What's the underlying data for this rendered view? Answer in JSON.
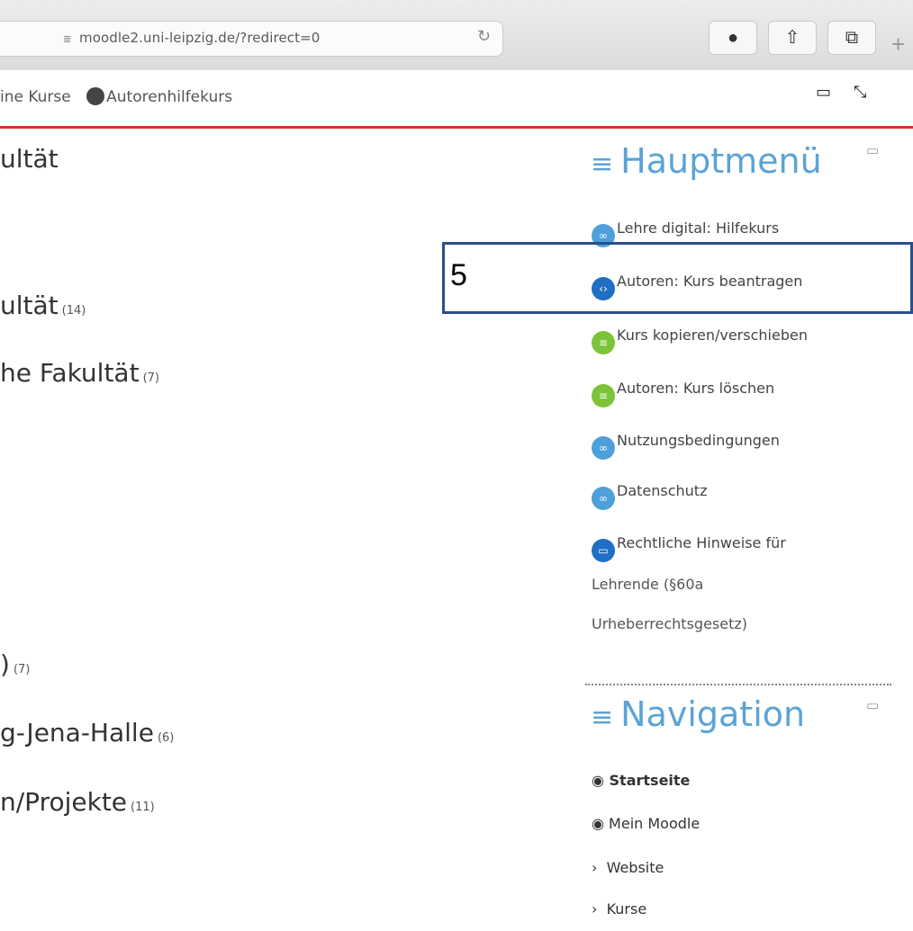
{
  "browser": {
    "url": "moodle2.uni-leipzig.de/?redirect=0",
    "buttons": [
      "reader-button",
      "share-button",
      "tabs-button"
    ]
  },
  "header": {
    "nav_left": "ine Kurse",
    "nav_course": "Autorenhilfekurs"
  },
  "categories": [
    {
      "name": "ultät",
      "count": ""
    },
    {
      "name": "ultät",
      "count": "(14)"
    },
    {
      "name": "he Fakultät",
      "count": "(7)"
    },
    {
      "name": "",
      "count": "(7)"
    },
    {
      "name": "g-Jena-Halle",
      "count": "(6)"
    },
    {
      "name": "n/Projekte",
      "count": "(11)"
    }
  ],
  "hauptmenu": {
    "title": "Hauptmenü",
    "items": [
      {
        "label": "Lehre digital: Hilfekurs",
        "icon": "link-icon",
        "color": "#4da0da"
      },
      {
        "label": "Autoren: Kurs beantragen",
        "icon": "code-icon",
        "color": "#1f6fc4"
      },
      {
        "label": "Kurs kopieren/verschieben",
        "icon": "doc-icon",
        "color": "#7cc339"
      },
      {
        "label": "Autoren: Kurs löschen",
        "icon": "doc-icon",
        "color": "#7cc339"
      },
      {
        "label": "Nutzungsbedingungen",
        "icon": "link-icon",
        "color": "#4da0da"
      },
      {
        "label": "Datenschutz",
        "icon": "link-icon",
        "color": "#4da0da"
      },
      {
        "label": "Rechtliche Hinweise für",
        "icon": "book-icon",
        "color": "#1f6fc4"
      }
    ],
    "wrap_lines": [
      "Lehrende (§60a",
      "Urheberrechtsgesetz)"
    ]
  },
  "navigation": {
    "title": "Navigation",
    "items": [
      {
        "label": "Startseite",
        "icon": "dashboard-icon"
      },
      {
        "label": "Mein Moodle",
        "icon": "dashboard-icon"
      },
      {
        "label": "Website",
        "icon": "chevron-right-icon"
      },
      {
        "label": "Kurse",
        "icon": "chevron-right-icon"
      }
    ]
  },
  "annotation": {
    "number": "5"
  }
}
